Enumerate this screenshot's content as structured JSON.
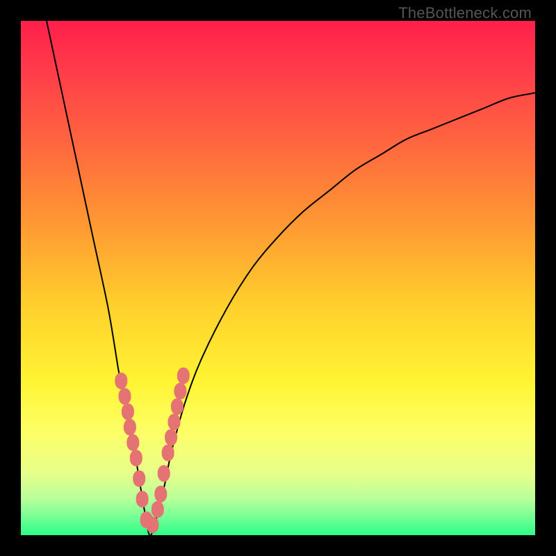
{
  "watermark": "TheBottleneck.com",
  "colors": {
    "frame": "#000000",
    "curve": "#000000",
    "marker_fill": "#e57373",
    "marker_stroke": "#8b2f2f"
  },
  "gradient_stops": [
    {
      "offset": 0.0,
      "color": "#ff1f4b"
    },
    {
      "offset": 0.1,
      "color": "#ff3d4a"
    },
    {
      "offset": 0.25,
      "color": "#ff6a3e"
    },
    {
      "offset": 0.4,
      "color": "#ff9a32"
    },
    {
      "offset": 0.55,
      "color": "#ffcf2c"
    },
    {
      "offset": 0.7,
      "color": "#fff433"
    },
    {
      "offset": 0.8,
      "color": "#fdff66"
    },
    {
      "offset": 0.88,
      "color": "#e7ff8a"
    },
    {
      "offset": 0.93,
      "color": "#b8ff9a"
    },
    {
      "offset": 0.97,
      "color": "#6bff94"
    },
    {
      "offset": 1.0,
      "color": "#2bff86"
    }
  ],
  "chart_data": {
    "type": "line",
    "title": "",
    "xlabel": "",
    "ylabel": "",
    "xlim": [
      0,
      100
    ],
    "ylim": [
      0,
      100
    ],
    "x_optimum": 25,
    "series": [
      {
        "name": "bottleneck-curve",
        "x": [
          5,
          8,
          11,
          14,
          17,
          19,
          20,
          21,
          22,
          23,
          24,
          25,
          26,
          27,
          28,
          29,
          30,
          32,
          35,
          40,
          45,
          50,
          55,
          60,
          65,
          70,
          75,
          80,
          85,
          90,
          95,
          100
        ],
        "y": [
          100,
          86,
          72,
          58,
          44,
          32,
          27,
          22,
          17,
          11,
          5,
          0,
          2,
          6,
          10,
          15,
          19,
          26,
          34,
          44,
          52,
          58,
          63,
          67,
          71,
          74,
          77,
          79,
          81,
          83,
          85,
          86
        ]
      }
    ],
    "markers": {
      "name": "highlighted-points",
      "x": [
        19.5,
        20.2,
        20.8,
        21.2,
        21.8,
        22.4,
        23.0,
        23.6,
        24.4,
        25.6,
        26.6,
        27.2,
        27.8,
        28.6,
        29.2,
        29.8,
        30.4,
        31.0,
        31.6
      ],
      "y": [
        30,
        27,
        24,
        21,
        18,
        15,
        11,
        7,
        3,
        2,
        5,
        8,
        12,
        16,
        19,
        22,
        25,
        28,
        31
      ]
    }
  }
}
